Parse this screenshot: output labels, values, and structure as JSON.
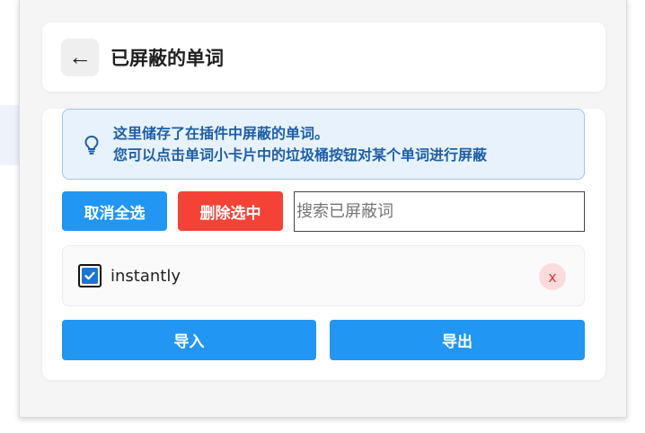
{
  "header": {
    "back_symbol": "←",
    "title": "已屏蔽的单词"
  },
  "info": {
    "icon": "lightbulb-icon",
    "line1": "这里储存了在插件中屏蔽的单词。",
    "line2": "您可以点击单词小卡片中的垃圾桶按钮对某个单词进行屏蔽"
  },
  "actions": {
    "deselect_all_label": "取消全选",
    "delete_selected_label": "删除选中",
    "search_placeholder": "搜索已屏蔽词",
    "search_value": ""
  },
  "words": [
    {
      "text": "instantly",
      "checked": true,
      "remove_label": "x"
    }
  ],
  "footer": {
    "import_label": "导入",
    "export_label": "导出"
  },
  "colors": {
    "primary": "#2196f3",
    "danger": "#f44336",
    "info_bg": "#e8f2fc",
    "info_text": "#1d5fa8"
  }
}
